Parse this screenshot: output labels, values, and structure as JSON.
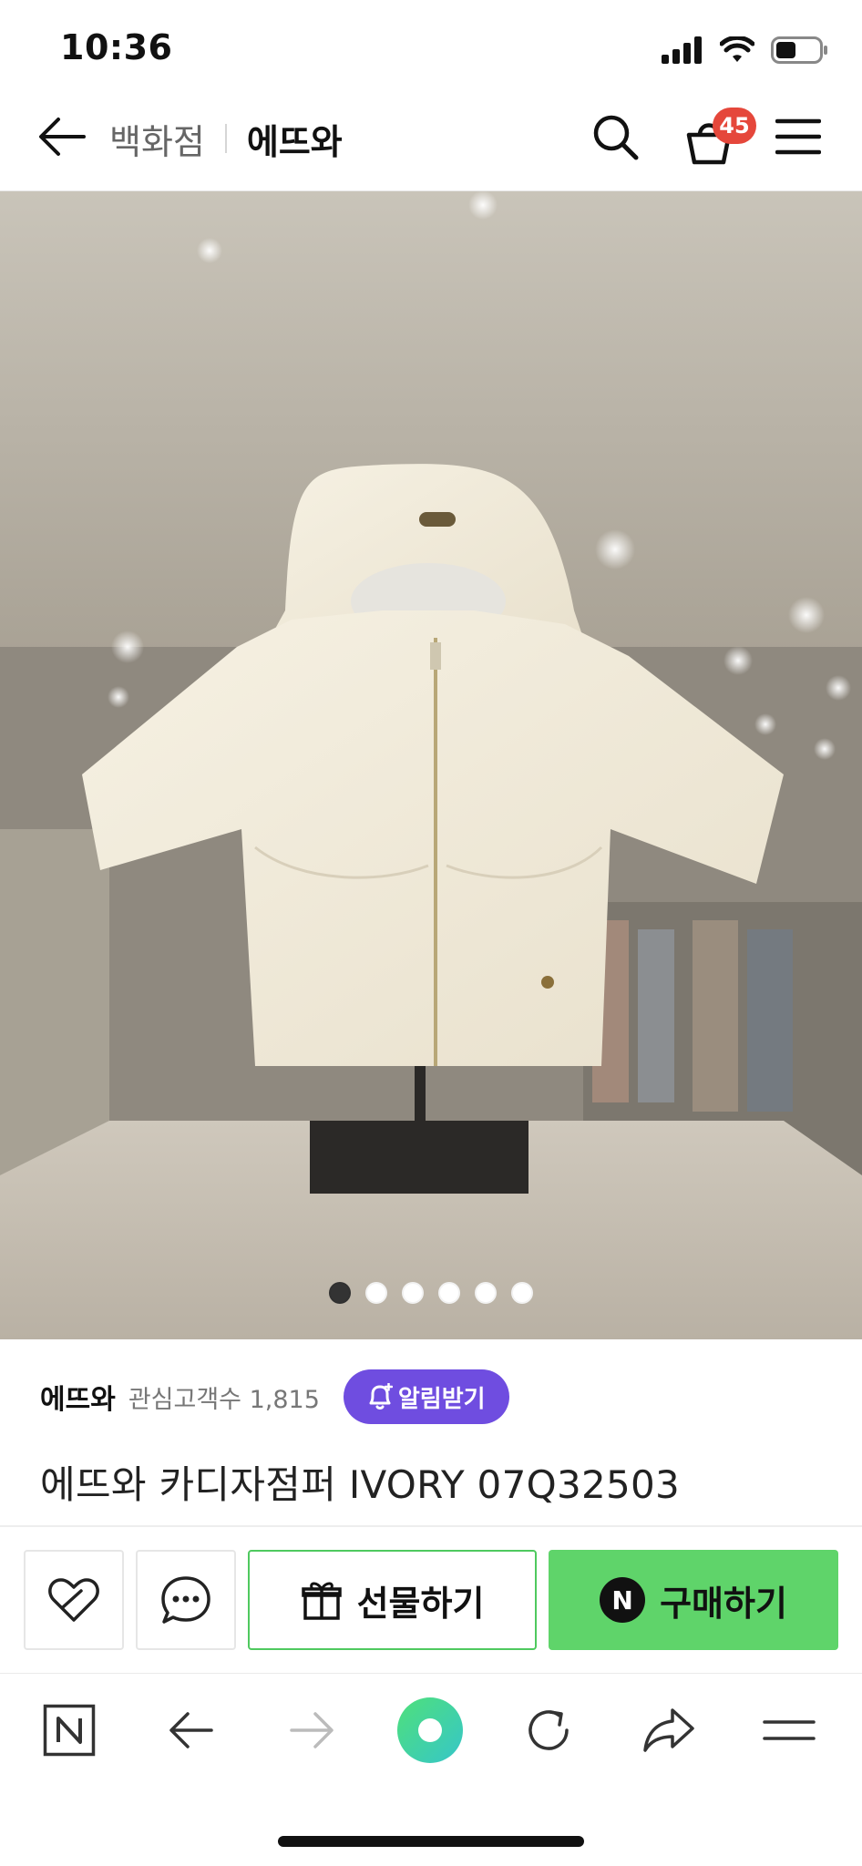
{
  "status_bar": {
    "time": "10:36",
    "battery_level": 0.45
  },
  "header": {
    "parent_label": "백화점",
    "current_label": "에뜨와",
    "cart_count": "45",
    "badge_color": "#e5473b"
  },
  "gallery": {
    "total_images": 6,
    "active_index": 0
  },
  "store": {
    "name": "에뜨와",
    "followers_text": "관심고객수 1,815",
    "alarm_label": "알림받기",
    "alarm_color": "#6f4de0"
  },
  "product": {
    "title": "에뜨와 카디자점퍼 IVORY 07Q32503"
  },
  "actions": {
    "gift_label": "선물하기",
    "buy_label": "구매하기",
    "buy_badge": "N",
    "buy_color": "#5fd46a"
  },
  "browser_toolbar": {
    "icons": [
      "naver-home-icon",
      "back-arrow-icon",
      "forward-arrow-icon",
      "green-dot-icon",
      "refresh-icon",
      "share-icon",
      "menu-icon"
    ]
  }
}
